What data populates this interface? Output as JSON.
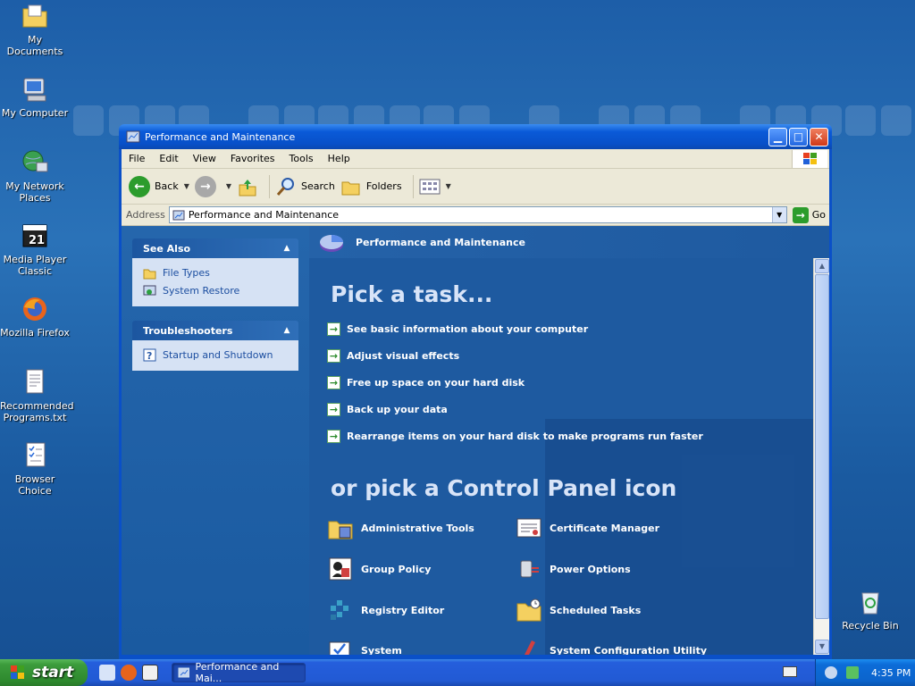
{
  "desktop": {
    "icons": [
      {
        "label": "My Documents"
      },
      {
        "label": "My Computer"
      },
      {
        "label": "My Network Places"
      },
      {
        "label": "Media Player Classic"
      },
      {
        "label": "Mozilla Firefox"
      },
      {
        "label": "Recommended Programs.txt"
      },
      {
        "label": "Browser Choice"
      },
      {
        "label": "Recycle Bin"
      }
    ]
  },
  "window": {
    "title": "Performance and Maintenance",
    "menu": [
      "File",
      "Edit",
      "View",
      "Favorites",
      "Tools",
      "Help"
    ],
    "toolbar": {
      "back_label": "Back",
      "search_label": "Search",
      "folders_label": "Folders"
    },
    "address": {
      "label": "Address",
      "value": "Performance and Maintenance",
      "go_label": "Go"
    },
    "left_pane": {
      "see_also": {
        "title": "See Also",
        "items": [
          "File Types",
          "System Restore"
        ]
      },
      "troubleshooters": {
        "title": "Troubleshooters",
        "items": [
          "Startup and Shutdown"
        ]
      }
    },
    "main": {
      "header": "Performance and Maintenance",
      "pick_task_title": "Pick a task...",
      "tasks": [
        "See basic information about your computer",
        "Adjust visual effects",
        "Free up space on your hard disk",
        "Back up your data",
        "Rearrange items on your hard disk to make programs run faster"
      ],
      "pick_icon_title": "or pick a Control Panel icon",
      "icons": [
        "Administrative Tools",
        "Certificate Manager",
        "Group Policy",
        "Power Options",
        "Registry Editor",
        "Scheduled Tasks",
        "System",
        "System Configuration Utility"
      ]
    }
  },
  "taskbar": {
    "start_label": "start",
    "task_label": "Performance and Mai...",
    "clock": "4:35 PM"
  }
}
